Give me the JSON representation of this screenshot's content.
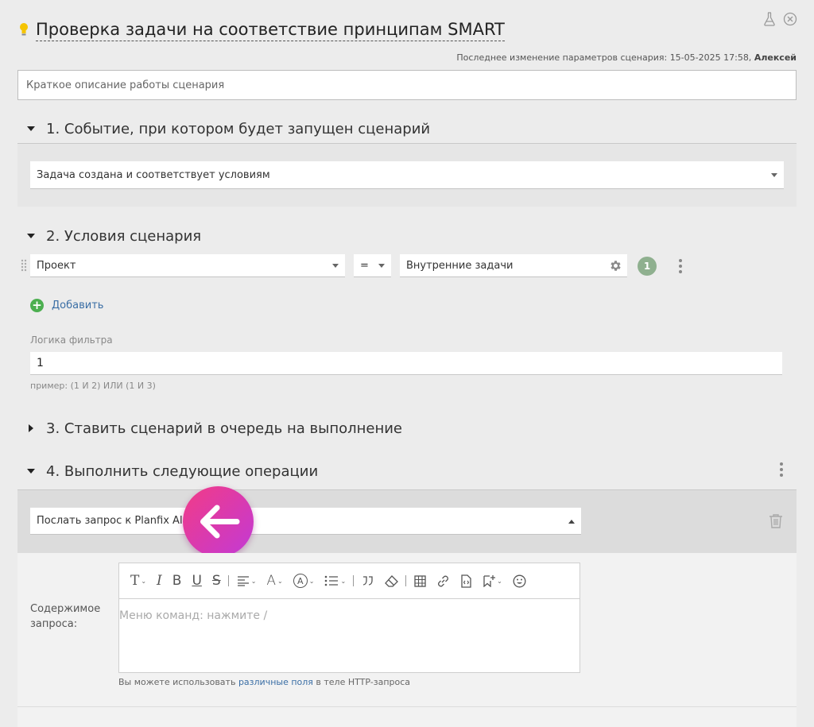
{
  "header": {
    "title": "Проверка задачи на соответствие принципам SMART",
    "last_modified_label": "Последнее изменение параметров сценария: 15-05-2025 17:58,",
    "last_modified_user": "Алексей"
  },
  "description": {
    "value": "Краткое описание работы сценария"
  },
  "sections": {
    "s1": {
      "title": "1. Событие, при котором будет запущен сценарий",
      "event_select": "Задача создана и соответствует условиям"
    },
    "s2": {
      "title": "2. Условия сценария",
      "condition": {
        "field": "Проект",
        "operator": "=",
        "value": "Внутренние задачи",
        "badge": "1"
      },
      "add_label": "Добавить",
      "filter_logic_label": "Логика фильтра",
      "filter_logic_value": "1",
      "filter_logic_hint": "пример: (1 И 2) ИЛИ (1 И 3)"
    },
    "s3": {
      "title": "3. Ставить сценарий в очередь на выполнение"
    },
    "s4": {
      "title": "4. Выполнить следующие операции",
      "operation_select": "Послать запрос к Planfix AI",
      "content_label": "Содержимое запроса:",
      "editor_placeholder": "Меню команд: нажмите /",
      "hint_prefix": "Вы можете использовать",
      "hint_link": "различные поля",
      "hint_suffix": "в теле HTTP-запроса"
    }
  },
  "toolbar_icons": [
    "text-style-icon",
    "italic-icon",
    "bold-icon",
    "underline-icon",
    "strikethrough-icon",
    "align-icon",
    "font-color-icon",
    "highlight-icon",
    "list-icon",
    "quote-icon",
    "clear-format-icon",
    "table-icon",
    "link-icon",
    "code-icon",
    "bookmark-icon",
    "emoji-icon"
  ],
  "toolbar_glyphs": {
    "text_style": "T",
    "italic": "I",
    "bold": "B",
    "underline": "U",
    "strike": "S",
    "font_color": "A",
    "highlight": "A"
  },
  "colors": {
    "accent_link": "#3a6ea5",
    "add_icon": "#4caf50",
    "badge": "#8fb08f",
    "arrow_gradient_start": "#f23b86",
    "arrow_gradient_end": "#c23ad6"
  }
}
